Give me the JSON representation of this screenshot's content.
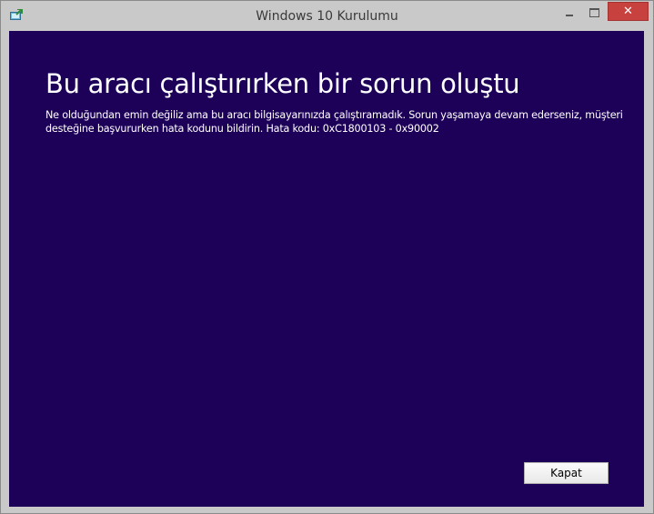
{
  "window": {
    "title": "Windows 10 Kurulumu",
    "icon": "setup-app-icon",
    "controls": {
      "minimize_icon": "minimize-icon",
      "maximize_icon": "maximize-icon",
      "close_icon": "close-icon",
      "close_glyph": "✕"
    }
  },
  "error": {
    "heading": "Bu aracı çalıştırırken bir sorun oluştu",
    "message": "Ne olduğundan emin değiliz ama bu aracı bilgisayarınızda çalıştıramadık. Sorun yaşamaya devam ederseniz, müşteri desteğine başvururken hata kodunu bildirin. Hata kodu: 0xC1800103 - 0x90002"
  },
  "footer": {
    "close_button_label": "Kapat"
  },
  "colors": {
    "background": "#1d0158",
    "text": "#ffffff",
    "close_button_red": "#c7413f",
    "frame": "#c9c9c9"
  }
}
